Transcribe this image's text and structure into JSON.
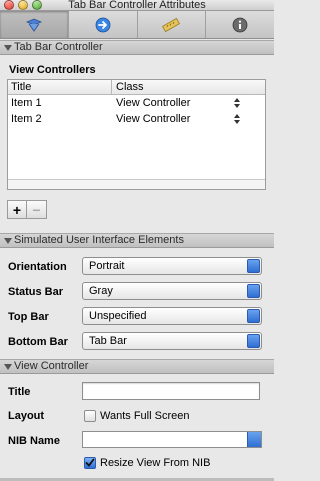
{
  "window": {
    "title": "Tab Bar Controller Attributes"
  },
  "toolbar": {
    "tabs": [
      {
        "icon": "attributes-icon",
        "active": true
      },
      {
        "icon": "connections-icon",
        "active": false
      },
      {
        "icon": "size-ruler-icon",
        "active": false
      },
      {
        "icon": "info-icon",
        "active": false
      }
    ]
  },
  "tab_bar_controller": {
    "header": "Tab Bar Controller",
    "view_controllers_label": "View Controllers",
    "columns": [
      "Title",
      "Class"
    ],
    "rows": [
      {
        "title": "Item 1",
        "class": "View Controller"
      },
      {
        "title": "Item 2",
        "class": "View Controller"
      }
    ],
    "add_label": "+",
    "remove_label": "−"
  },
  "simulated": {
    "header": "Simulated User Interface Elements",
    "orientation_label": "Orientation",
    "orientation_value": "Portrait",
    "status_bar_label": "Status Bar",
    "status_bar_value": "Gray",
    "top_bar_label": "Top Bar",
    "top_bar_value": "Unspecified",
    "bottom_bar_label": "Bottom Bar",
    "bottom_bar_value": "Tab Bar"
  },
  "view_controller": {
    "header": "View Controller",
    "title_label": "Title",
    "title_value": "",
    "layout_label": "Layout",
    "wants_full_screen_label": "Wants Full Screen",
    "wants_full_screen_checked": false,
    "nib_name_label": "NIB Name",
    "nib_name_value": "",
    "resize_label": "Resize View From NIB",
    "resize_checked": true
  },
  "colors": {
    "accent": "#2f6fd2"
  }
}
